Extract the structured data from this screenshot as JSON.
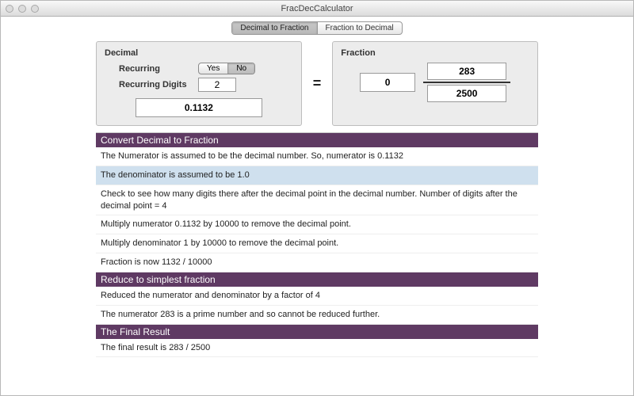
{
  "window": {
    "title": "FracDecCalculator"
  },
  "tabs": {
    "dec2frac": "Decimal to Fraction",
    "frac2dec": "Fraction to Decimal"
  },
  "decimal_panel": {
    "title": "Decimal",
    "recurring_label": "Recurring",
    "yes": "Yes",
    "no": "No",
    "digits_label": "Recurring Digits",
    "digits_value": "2",
    "value": "0.1132"
  },
  "eq": "=",
  "fraction_panel": {
    "title": "Fraction",
    "whole": "0",
    "numerator": "283",
    "denominator": "2500"
  },
  "section1": {
    "title": "Convert Decimal to Fraction",
    "s1": "The Numerator is assumed to be the decimal number.  So, numerator is 0.1132",
    "s2": "The denominator is assumed to be 1.0",
    "s3": "Check to see how many digits there after the decimal point in the decimal number. Number of digits after the decimal point = 4",
    "s4": "Multiply numerator 0.1132 by 10000 to remove the decimal point.",
    "s5": "Multiply denominator 1 by 10000 to remove the decimal point.",
    "s6": "Fraction is now 1132 / 10000"
  },
  "section2": {
    "title": "Reduce to simplest fraction",
    "s1": "Reduced the numerator and denominator by a factor of 4",
    "s2": "The numerator 283 is a prime number and so cannot be reduced further."
  },
  "section3": {
    "title": "The Final Result",
    "s1": "The final result is 283 / 2500"
  }
}
